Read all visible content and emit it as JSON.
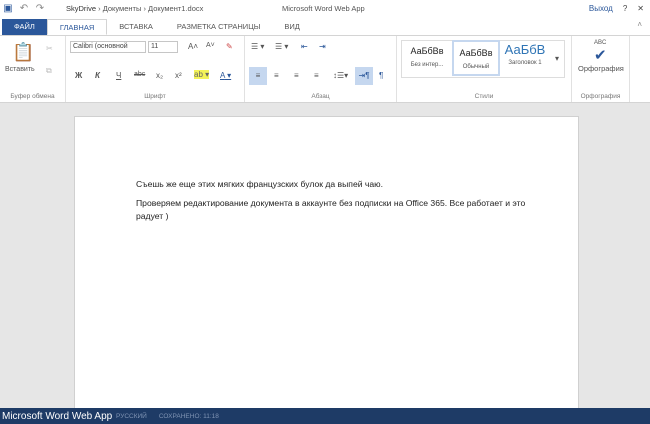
{
  "titlebar": {
    "breadcrumb": [
      "SkyDrive",
      "Документы",
      "Документ1.docx"
    ],
    "app_title": "Microsoft Word Web App",
    "exit": "Выход",
    "help": "?",
    "close": "✕"
  },
  "tabs": [
    "ФАЙЛ",
    "ГЛАВНАЯ",
    "ВСТАВКА",
    "РАЗМЕТКА СТРАНИЦЫ",
    "ВИД"
  ],
  "ribbon": {
    "clipboard": {
      "paste": "Вставить",
      "label": "Буфер обмена"
    },
    "font": {
      "name": "Calibri (основной",
      "size": "11",
      "label": "Шрифт",
      "bold": "Ж",
      "italic": "К",
      "underline": "Ч",
      "strike": "abc",
      "sub": "x₂",
      "sup": "x²",
      "color": "A"
    },
    "paragraph": {
      "label": "Абзац"
    },
    "styles": {
      "items": [
        {
          "preview": "АаБбВв",
          "name": "Без интер..."
        },
        {
          "preview": "АаБбВв",
          "name": "Обычный"
        },
        {
          "preview": "АаБбВ",
          "name": "Заголовок 1"
        }
      ],
      "label": "Стили"
    },
    "spelling": {
      "icon_text": "ABC",
      "button": "Орфография",
      "label": "Орфография"
    }
  },
  "document": {
    "paragraphs": [
      "Съешь же еще этих мягких французских булок да выпей чаю.",
      "Проверяем редактирование документа в аккаунте без подписки на Office 365. Все работает и это радует )"
    ]
  },
  "statusbar": {
    "app": "Microsoft Word Web App",
    "language": "РУССКИЙ",
    "saved": "СОХРАНЕНО: 11:18"
  },
  "colors": {
    "accent": "#2b579a",
    "status": "#1e3b66"
  }
}
